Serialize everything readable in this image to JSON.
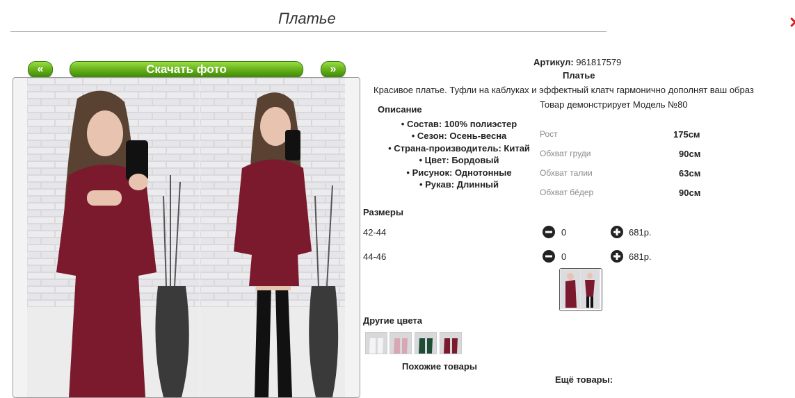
{
  "page": {
    "title": "Платье"
  },
  "nav": {
    "prev": "«",
    "download": "Скачать фото",
    "next": "»"
  },
  "product": {
    "article_label": "Артикул:",
    "article_value": "961817579",
    "name": "Платье",
    "description": "Красивое платье. Туфли на каблуках и эффектный клатч гармонично дополнят ваш образ",
    "model_note": "Товар демонстрирует Модель №80"
  },
  "specs": {
    "heading": "Описание",
    "items": [
      "Состав: 100% полиэстер",
      "Сезон: Осень-весна",
      "Страна-производитель: Китай",
      "Цвет: Бордовый",
      "Рисунок: Однотонные",
      "Рукав: Длинный"
    ]
  },
  "measurements": [
    {
      "label": "Рост",
      "value": "175см"
    },
    {
      "label": "Обхват груди",
      "value": "90см"
    },
    {
      "label": "Обхват талии",
      "value": "63см"
    },
    {
      "label": "Обхват бёдер",
      "value": "90см"
    }
  ],
  "sizes": {
    "heading": "Размеры",
    "rows": [
      {
        "size": "42-44",
        "qty": "0",
        "price": "681р."
      },
      {
        "size": "44-46",
        "qty": "0",
        "price": "681р."
      }
    ]
  },
  "other_colors": {
    "heading": "Другие цвета"
  },
  "similar": {
    "heading": "Похожие товары"
  },
  "more": {
    "heading": "Ещё товары:"
  },
  "colors": {
    "green_btn": "#6bb51d",
    "dress": "#7a1a2c",
    "accent_red": "#d32020"
  }
}
